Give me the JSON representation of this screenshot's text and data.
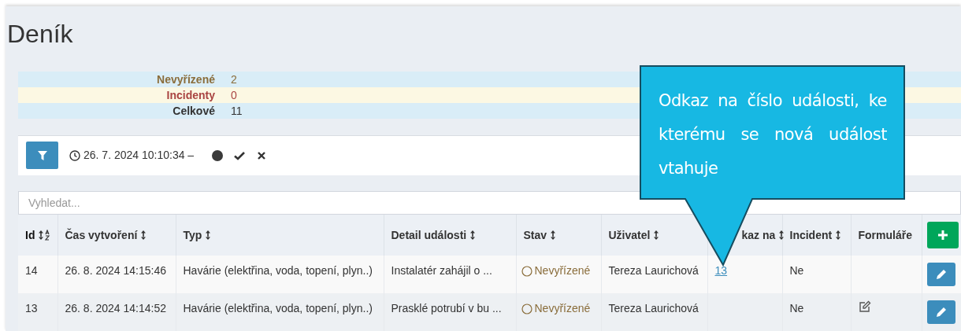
{
  "title": "Deník",
  "summary": [
    {
      "label": "Nevyřízené",
      "value": "2",
      "kind": "pending"
    },
    {
      "label": "Incidenty",
      "value": "0",
      "kind": "incident"
    },
    {
      "label": "Celkové",
      "value": "11",
      "kind": "total"
    }
  ],
  "filter": {
    "date_range": "26. 7. 2024 10:10:34 –"
  },
  "search": {
    "placeholder": "Vyhledat..."
  },
  "table": {
    "columns": [
      {
        "label": "Id",
        "sortable": true,
        "sorted": true
      },
      {
        "label": "Čas vytvoření",
        "sortable": true,
        "sorted": false
      },
      {
        "label": "Typ",
        "sortable": true,
        "sorted": false
      },
      {
        "label": "Detail události",
        "sortable": true,
        "sorted": false
      },
      {
        "label": "Stav",
        "sortable": true,
        "sorted": false
      },
      {
        "label": "Uživatel",
        "sortable": true,
        "sorted": false
      },
      {
        "label": "kaz na",
        "sortable": true,
        "sorted": false
      },
      {
        "label": "Incident",
        "sortable": true,
        "sorted": false
      },
      {
        "label": "Formuláře",
        "sortable": false,
        "sorted": false
      }
    ],
    "rows": [
      {
        "id": "14",
        "created": "26. 8. 2024 14:15:46",
        "type": "Havárie (elektřina, voda, topení, plyn..)",
        "detail": "Instalatér zahájil o ...",
        "status": "Nevyřízené",
        "user": "Tereza Laurichová",
        "link": "13",
        "incident": "Ne",
        "has_form": false
      },
      {
        "id": "13",
        "created": "26. 8. 2024 14:14:52",
        "type": "Havárie (elektřina, voda, topení, plyn..)",
        "detail": "Prasklé potrubí v bu ...",
        "status": "Nevyřízené",
        "user": "Tereza Laurichová",
        "incident": "Ne",
        "has_form": true
      }
    ]
  },
  "callout": {
    "text": "Odkaz na číslo události, ke kterému se nová událost vtahuje"
  }
}
